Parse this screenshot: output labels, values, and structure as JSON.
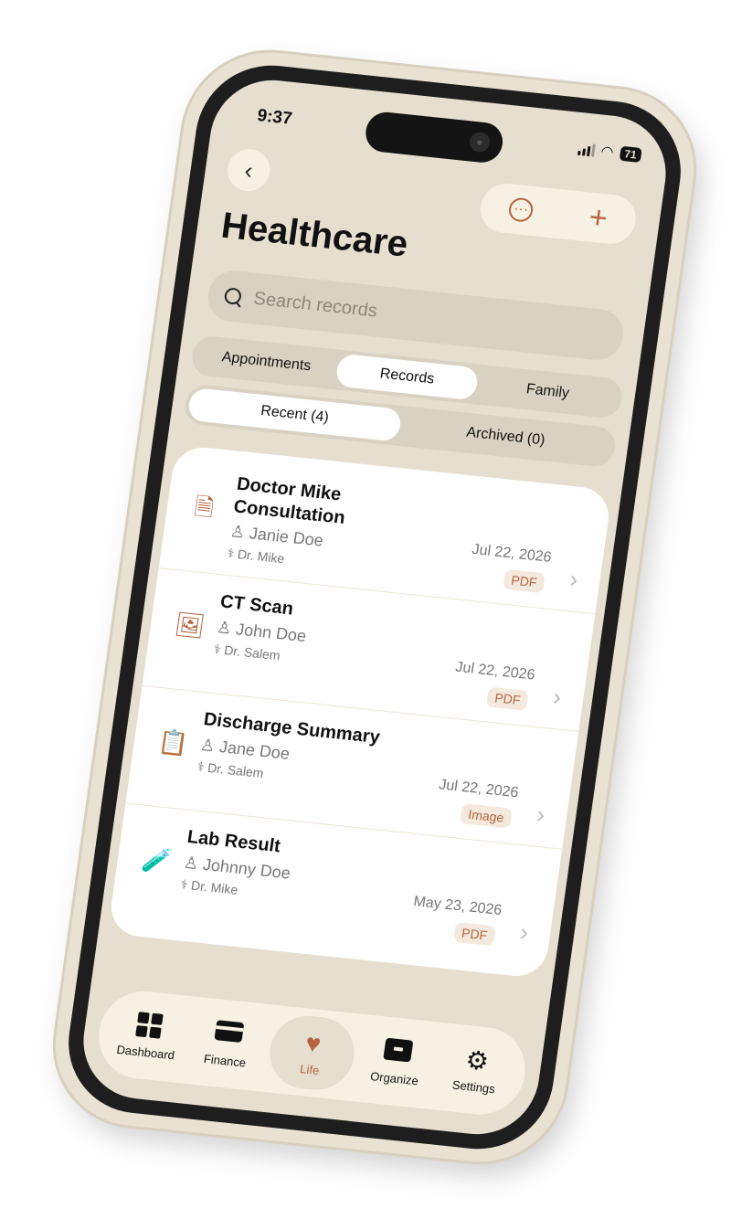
{
  "status": {
    "time": "9:37",
    "battery": "71"
  },
  "header": {
    "title": "Healthcare"
  },
  "search": {
    "placeholder": "Search records"
  },
  "tabs": {
    "primary": [
      {
        "label": "Appointments",
        "active": false
      },
      {
        "label": "Records",
        "active": true
      },
      {
        "label": "Family",
        "active": false
      }
    ],
    "secondary": [
      {
        "label": "Recent (4)",
        "active": true
      },
      {
        "label": "Archived (0)",
        "active": false
      }
    ]
  },
  "records": [
    {
      "title": "Doctor Mike Consultation",
      "patient": "Janie Doe",
      "doctor": "Dr. Mike",
      "date": "Jul 22, 2026",
      "type": "PDF",
      "icon": "document-icon"
    },
    {
      "title": "CT Scan",
      "patient": "John Doe",
      "doctor": "Dr. Salem",
      "date": "Jul 22, 2026",
      "type": "PDF",
      "icon": "image-icon"
    },
    {
      "title": "Discharge Summary",
      "patient": "Jane Doe",
      "doctor": "Dr. Salem",
      "date": "Jul 22, 2026",
      "type": "Image",
      "icon": "clipboard-icon"
    },
    {
      "title": "Lab Result",
      "patient": "Johnny Doe",
      "doctor": "Dr. Mike",
      "date": "May 23, 2026",
      "type": "PDF",
      "icon": "test-tubes-icon"
    }
  ],
  "nav": [
    {
      "label": "Dashboard",
      "icon": "dashboard-icon",
      "active": false
    },
    {
      "label": "Finance",
      "icon": "credit-card-icon",
      "active": false
    },
    {
      "label": "Life",
      "icon": "heart-icon",
      "active": true
    },
    {
      "label": "Organize",
      "icon": "archive-box-icon",
      "active": false
    },
    {
      "label": "Settings",
      "icon": "gear-icon",
      "active": false
    }
  ],
  "colors": {
    "accent": "#b5643f",
    "background": "#e6dfcf",
    "surface": "#f7f1e3"
  }
}
